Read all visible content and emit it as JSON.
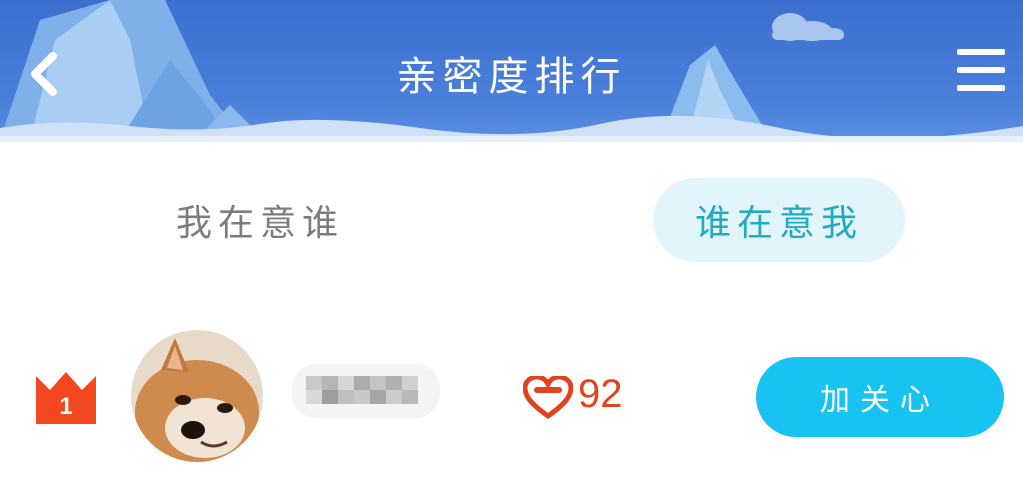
{
  "header": {
    "title": "亲密度排行",
    "back_icon": "chevron-left-icon",
    "menu_icon": "hamburger-menu-icon",
    "background_color": "#4a7fdb"
  },
  "tabs": [
    {
      "label": "我在意谁",
      "selected": false
    },
    {
      "label": "谁在意我",
      "selected": true
    }
  ],
  "ranking": [
    {
      "rank": "1",
      "rank_icon": "crown-icon",
      "avatar": "shiba-dog-avatar",
      "name_blurred": true,
      "heart_icon": "heart-icon",
      "intimacy": "92",
      "action_label": "加关心"
    }
  ],
  "colors": {
    "accent": "#18c3f1",
    "heart": "#e0441f",
    "tab_active_text": "#22a9c4",
    "tab_active_bg": "#e2f5fc"
  }
}
